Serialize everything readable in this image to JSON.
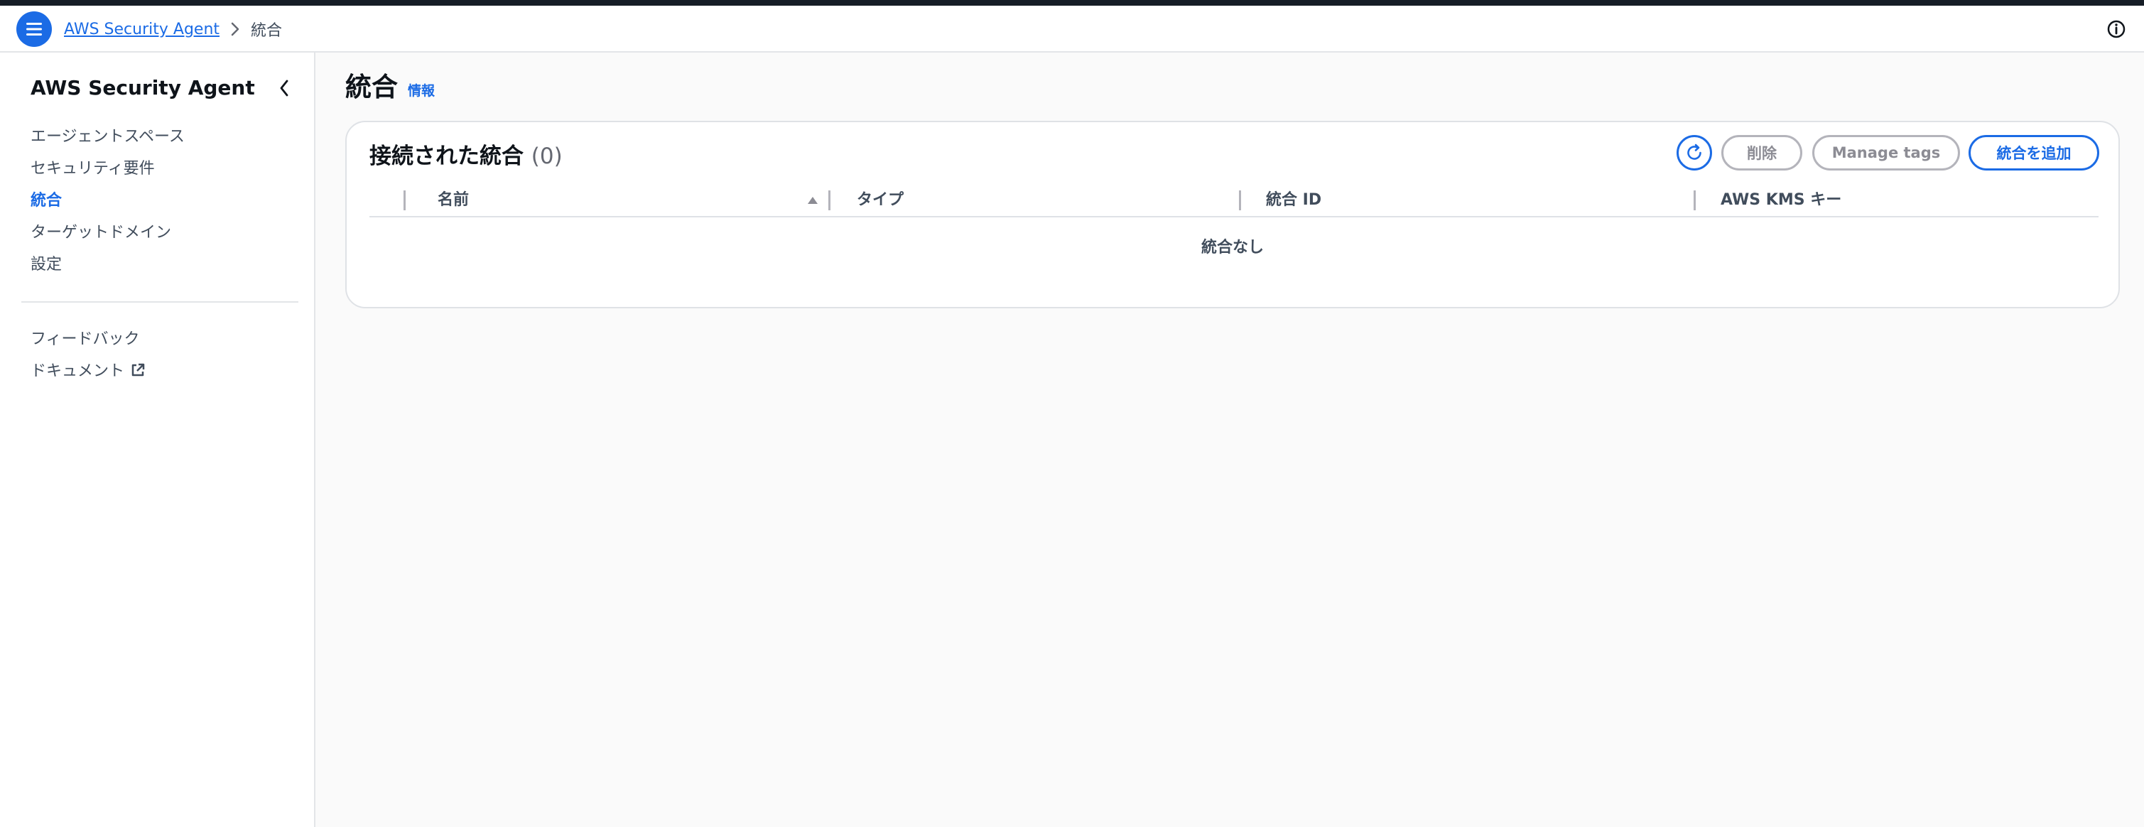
{
  "header": {
    "breadcrumb_root": "AWS Security Agent",
    "breadcrumb_current": "統合"
  },
  "sidebar": {
    "title": "AWS Security Agent",
    "items": [
      {
        "label": "エージェントスペース"
      },
      {
        "label": "セキュリティ要件"
      },
      {
        "label": "統合"
      },
      {
        "label": "ターゲットドメイン"
      },
      {
        "label": "設定"
      }
    ],
    "secondary_items": [
      {
        "label": "フィードバック"
      },
      {
        "label": "ドキュメント"
      }
    ]
  },
  "main": {
    "title": "統合",
    "info_link": "情報",
    "table": {
      "title": "接続された統合",
      "count": "(0)",
      "buttons": {
        "delete": "削除",
        "manage_tags": "Manage tags",
        "add": "統合を追加"
      },
      "columns": [
        "名前",
        "タイプ",
        "統合 ID",
        "AWS KMS キー"
      ],
      "empty_message": "統合なし"
    }
  },
  "colors": {
    "accent": "#1b6be5",
    "text_primary": "#0f141a",
    "text_secondary": "#414d5c",
    "disabled": "#b4b4bb",
    "top_strip": "#161d26"
  },
  "icons": {
    "menu": "menu-icon",
    "breadcrumb_separator": "chevron-right-icon",
    "info": "info-icon",
    "collapse": "chevron-left-icon",
    "external": "external-link-icon",
    "refresh": "refresh-icon",
    "sort": "sort-ascending-icon"
  }
}
